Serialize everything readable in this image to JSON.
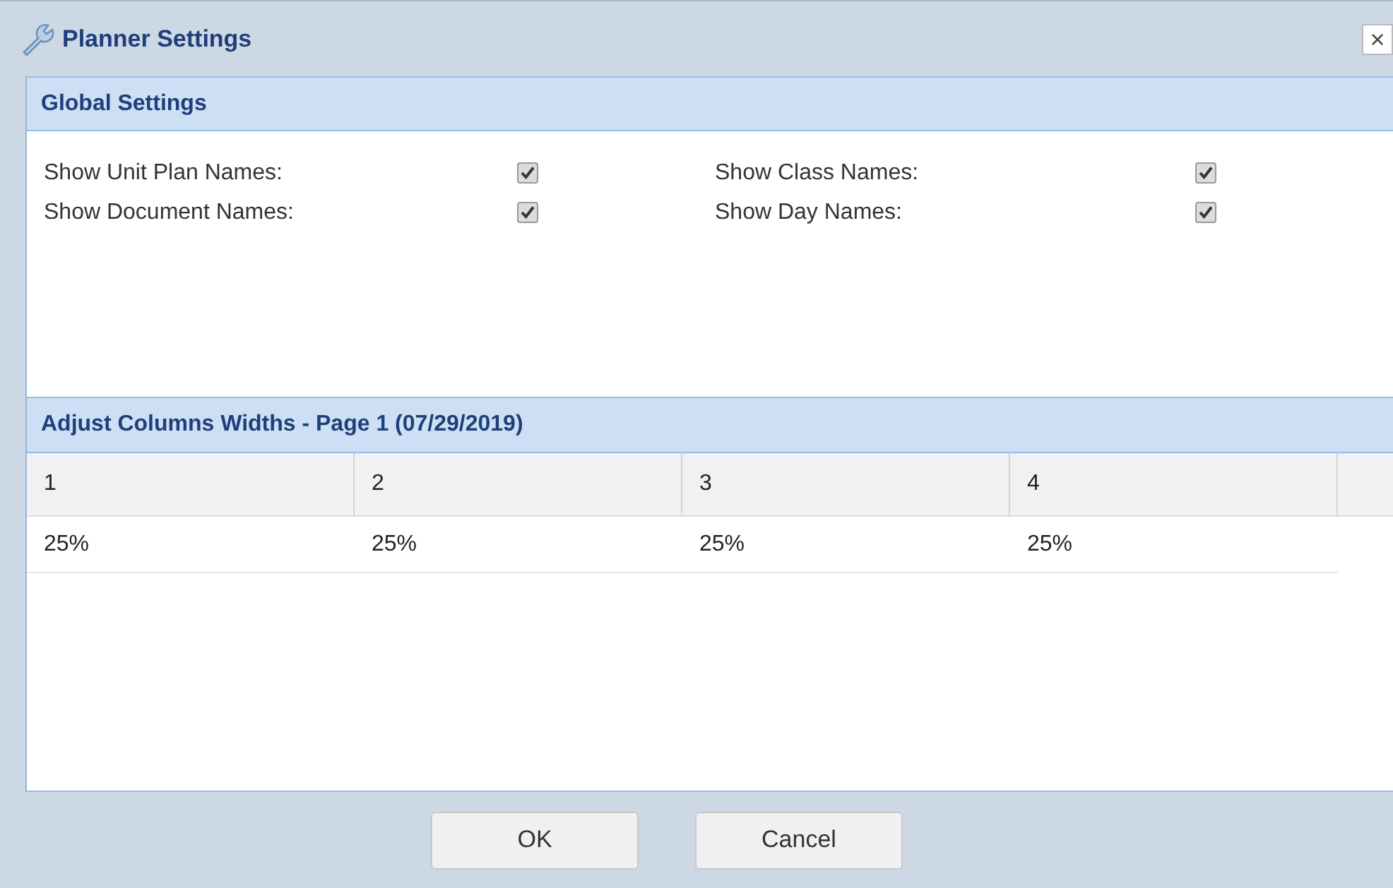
{
  "window": {
    "title": "Planner Settings",
    "close": "×"
  },
  "global_settings": {
    "title": "Global Settings",
    "options": [
      {
        "label": "Show Unit Plan Names:",
        "checked": true
      },
      {
        "label": "Show Class Names:",
        "checked": true
      },
      {
        "label": "Show Document Names:",
        "checked": true
      },
      {
        "label": "Show Day Names:",
        "checked": true
      }
    ]
  },
  "column_widths": {
    "title": "Adjust Columns Widths - Page 1 (07/29/2019)",
    "columns": [
      "1",
      "2",
      "3",
      "4"
    ],
    "row": [
      "25%",
      "25%",
      "25%",
      "25%"
    ]
  },
  "buttons": [
    "OK",
    "Cancel"
  ]
}
